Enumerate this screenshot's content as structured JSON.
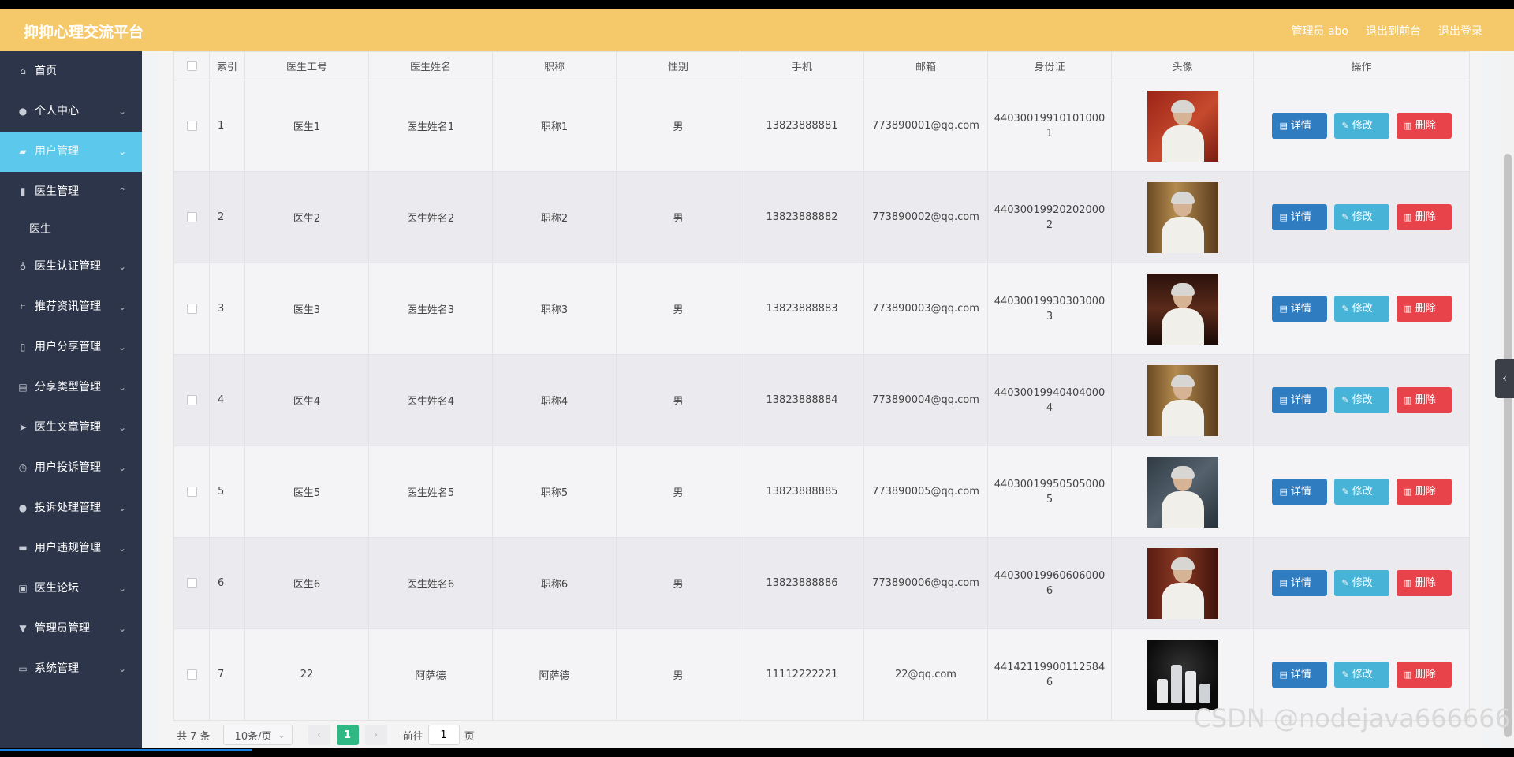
{
  "header": {
    "title": "抑抑心理交流平台",
    "user_label": "管理员 abo",
    "back_label": "退出到前台",
    "logout_label": "退出登录"
  },
  "sidebar": {
    "items": [
      {
        "label": "首页",
        "icon": "home-icon"
      },
      {
        "label": "个人中心",
        "icon": "user-icon"
      },
      {
        "label": "用户管理",
        "icon": "users-icon"
      },
      {
        "label": "医生管理",
        "icon": "chart-icon"
      },
      {
        "label": "医生认证管理",
        "icon": "mic-icon"
      },
      {
        "label": "推荐资讯管理",
        "icon": "crop-icon"
      },
      {
        "label": "用户分享管理",
        "icon": "share-icon"
      },
      {
        "label": "分享类型管理",
        "icon": "clipboard-icon"
      },
      {
        "label": "医生文章管理",
        "icon": "send-icon"
      },
      {
        "label": "用户投诉管理",
        "icon": "clock-icon"
      },
      {
        "label": "投诉处理管理",
        "icon": "bulb-icon"
      },
      {
        "label": "用户违规管理",
        "icon": "printer-icon"
      },
      {
        "label": "医生论坛",
        "icon": "image-icon"
      },
      {
        "label": "管理员管理",
        "icon": "flag-icon"
      },
      {
        "label": "系统管理",
        "icon": "monitor-icon"
      }
    ],
    "sub_doctor": "医生"
  },
  "table": {
    "headers": [
      "",
      "索引",
      "医生工号",
      "医生姓名",
      "职称",
      "性别",
      "手机",
      "邮箱",
      "身份证",
      "头像",
      "操作"
    ],
    "rows": [
      {
        "index": "1",
        "number": "医生1",
        "name": "医生姓名1",
        "title": "职称1",
        "gender": "男",
        "phone": "13823888881",
        "email": "773890001@qq.com",
        "id_card": "440300199101010001"
      },
      {
        "index": "2",
        "number": "医生2",
        "name": "医生姓名2",
        "title": "职称2",
        "gender": "男",
        "phone": "13823888882",
        "email": "773890002@qq.com",
        "id_card": "440300199202020002"
      },
      {
        "index": "3",
        "number": "医生3",
        "name": "医生姓名3",
        "title": "职称3",
        "gender": "男",
        "phone": "13823888883",
        "email": "773890003@qq.com",
        "id_card": "440300199303030003"
      },
      {
        "index": "4",
        "number": "医生4",
        "name": "医生姓名4",
        "title": "职称4",
        "gender": "男",
        "phone": "13823888884",
        "email": "773890004@qq.com",
        "id_card": "440300199404040004"
      },
      {
        "index": "5",
        "number": "医生5",
        "name": "医生姓名5",
        "title": "职称5",
        "gender": "男",
        "phone": "13823888885",
        "email": "773890005@qq.com",
        "id_card": "440300199505050005"
      },
      {
        "index": "6",
        "number": "医生6",
        "name": "医生姓名6",
        "title": "职称6",
        "gender": "男",
        "phone": "13823888886",
        "email": "773890006@qq.com",
        "id_card": "440300199606060006"
      },
      {
        "index": "7",
        "number": "22",
        "name": "阿萨德",
        "title": "阿萨德",
        "gender": "男",
        "phone": "11112222221",
        "email": "22@qq.com",
        "id_card": "441421199001125846"
      }
    ],
    "actions": {
      "detail": "详情",
      "edit": "修改",
      "delete": "删除"
    }
  },
  "pagination": {
    "total": "共 7 条",
    "page_size": "10条/页",
    "current_page": "1",
    "goto_label": "前往",
    "goto_value": "1",
    "page_unit": "页"
  },
  "watermark": "CSDN @nodejava666666",
  "colors": {
    "header_bg": "#f5c969",
    "sidebar_bg": "#2c3549",
    "sidebar_active": "#5bc8ec",
    "btn_detail": "#2f7cc1",
    "btn_edit": "#46b3d7",
    "btn_delete": "#e8434a",
    "page_active": "#2fb784"
  }
}
